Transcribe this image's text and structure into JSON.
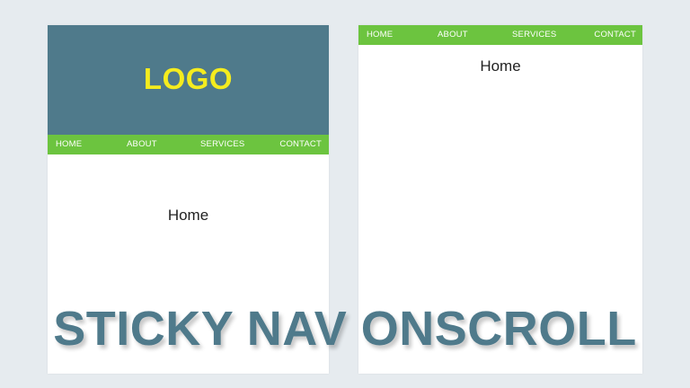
{
  "left_panel": {
    "logo": "LOGO",
    "nav": [
      "HOME",
      "ABOUT",
      "SERVICES",
      "CONTACT"
    ],
    "content_title": "Home"
  },
  "right_panel": {
    "nav": [
      "HOME",
      "ABOUT",
      "SERVICES",
      "CONTACT"
    ],
    "content_title": "Home"
  },
  "overlay_title": "STICKY NAV ONSCROLL",
  "colors": {
    "background": "#e6ebef",
    "header": "#4f7a8b",
    "logo": "#f5ec1e",
    "nav": "#6cc43f",
    "title_text": "#4f7a8b"
  }
}
